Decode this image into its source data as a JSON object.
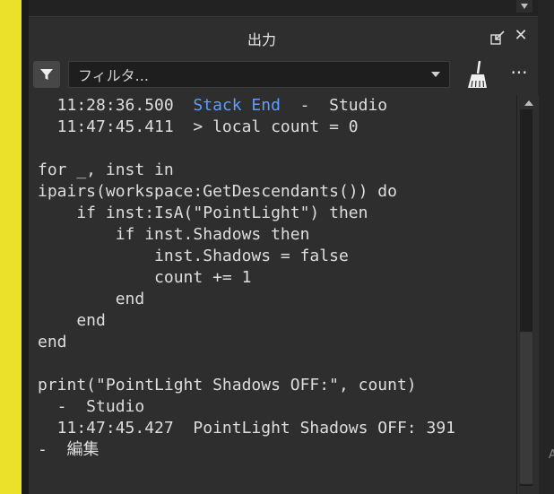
{
  "window": {
    "title": "出力"
  },
  "toolbar": {
    "filter_placeholder": "フィルタ...",
    "more_label": "···"
  },
  "output": {
    "line1_time": "  11:28:36.500  ",
    "line1_msg": "Stack End",
    "line1_tail": "  -  Studio",
    "line2": "  11:47:45.411  > local count = 0",
    "line3": "",
    "line4": "for _, inst in",
    "line5": "ipairs(workspace:GetDescendants()) do",
    "line6": "    if inst:IsA(\"PointLight\") then",
    "line7": "        if inst.Shadows then",
    "line8": "            inst.Shadows = false",
    "line9": "            count += 1",
    "line10": "        end",
    "line11": "    end",
    "line12": "end",
    "line13": "",
    "line14": "print(\"PointLight Shadows OFF:\", count)",
    "line15": "  -  Studio",
    "line16": "  11:47:45.427  PointLight Shadows OFF: 391",
    "line17": "-  編集"
  },
  "colors": {
    "accent_blue": "#5f9cff",
    "background": "#2e2e2e",
    "yellow_strip": "#ece12a"
  }
}
